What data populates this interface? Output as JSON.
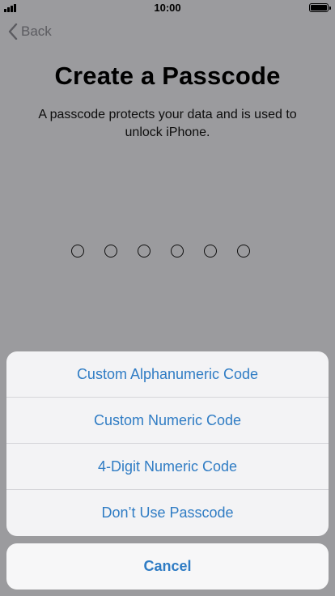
{
  "status_bar": {
    "time": "10:00",
    "signal_bars": 4,
    "battery_level": 1.0
  },
  "nav": {
    "back_label": "Back"
  },
  "main": {
    "title": "Create a Passcode",
    "subtitle": "A passcode protects your data and is used to unlock iPhone.",
    "passcode_length": 6,
    "entered_digits": 0
  },
  "action_sheet": {
    "options": [
      {
        "label": "Custom Alphanumeric Code"
      },
      {
        "label": "Custom Numeric Code"
      },
      {
        "label": "4-Digit Numeric Code"
      },
      {
        "label": "Don’t Use Passcode"
      }
    ],
    "cancel_label": "Cancel"
  },
  "colors": {
    "accent": "#2f7cc4",
    "dimmed_background": "#9b9b9e",
    "sheet_background": "#f3f3f5"
  },
  "icons": {
    "back": "chevron-left-icon",
    "signal": "signal-icon",
    "battery": "battery-icon"
  }
}
